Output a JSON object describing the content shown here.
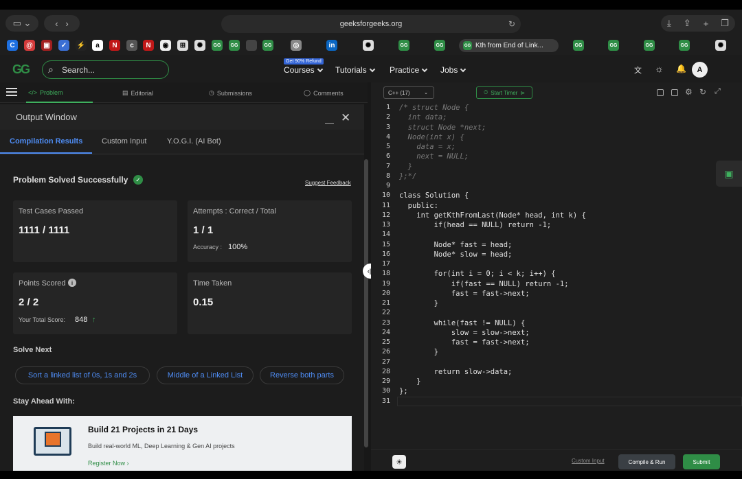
{
  "browser": {
    "url": "geeksforgeeks.org",
    "active_tab": "Kth from End of Link..."
  },
  "header": {
    "search_placeholder": "Search...",
    "badge": "Get 90% Refund",
    "nav": [
      "Courses",
      "Tutorials",
      "Practice",
      "Jobs"
    ],
    "avatar": "A"
  },
  "problem_tabs": {
    "problem": "Problem",
    "editorial": "Editorial",
    "submissions": "Submissions",
    "comments": "Comments"
  },
  "output": {
    "title": "Output Window",
    "tabs": [
      "Compilation Results",
      "Custom Input",
      "Y.O.G.I. (AI Bot)"
    ],
    "status": "Problem Solved Successfully",
    "feedback": "Suggest Feedback",
    "tests_label": "Test Cases Passed",
    "tests_value": "1111 / 1111",
    "attempts_label": "Attempts : Correct / Total",
    "attempts_value": "1 / 1",
    "accuracy_label": "Accuracy :",
    "accuracy_value": "100%",
    "points_label": "Points Scored",
    "points_value": "2 / 2",
    "total_label": "Your Total Score:",
    "total_value": "848",
    "time_label": "Time Taken",
    "time_value": "0.15",
    "solve_next": "Solve Next",
    "next_problems": [
      "Sort a linked list of 0s, 1s and 2s",
      "Middle of a Linked List",
      "Reverse both parts"
    ],
    "stay_ahead": "Stay Ahead With:",
    "promo_title": "Build 21 Projects in 21 Days",
    "promo_sub": "Build real-world ML, Deep Learning & Gen AI projects",
    "promo_link": "Register Now ›"
  },
  "editor": {
    "language": "C++ (17)",
    "timer": "Start Timer",
    "lines": [
      "/* struct Node {",
      "  int data;",
      "  struct Node *next;",
      "  Node(int x) {",
      "    data = x;",
      "    next = NULL;",
      "  }",
      "};*/",
      "",
      "class Solution {",
      "  public:",
      "    int getKthFromLast(Node* head, int k) {",
      "        if(head == NULL) return -1;",
      "",
      "        Node* fast = head;",
      "        Node* slow = head;",
      "",
      "        for(int i = 0; i < k; i++) {",
      "            if(fast == NULL) return -1;",
      "            fast = fast->next;",
      "        }",
      "",
      "        while(fast != NULL) {",
      "            slow = slow->next;",
      "            fast = fast->next;",
      "        }",
      "",
      "        return slow->data;",
      "    }",
      "};",
      ""
    ],
    "custom_input": "Custom Input",
    "compile": "Compile & Run",
    "submit": "Submit"
  }
}
